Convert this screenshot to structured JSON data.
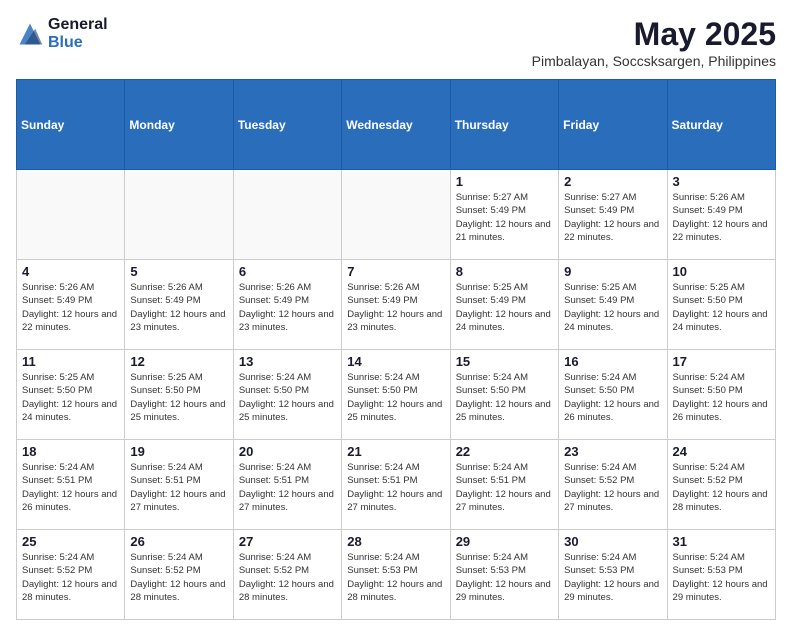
{
  "logo": {
    "general": "General",
    "blue": "Blue"
  },
  "title": {
    "month_year": "May 2025",
    "location": "Pimbalayan, Soccsksargen, Philippines"
  },
  "weekdays": [
    "Sunday",
    "Monday",
    "Tuesday",
    "Wednesday",
    "Thursday",
    "Friday",
    "Saturday"
  ],
  "weeks": [
    [
      {
        "day": "",
        "info": ""
      },
      {
        "day": "",
        "info": ""
      },
      {
        "day": "",
        "info": ""
      },
      {
        "day": "",
        "info": ""
      },
      {
        "day": "1",
        "info": "Sunrise: 5:27 AM\nSunset: 5:49 PM\nDaylight: 12 hours and 21 minutes."
      },
      {
        "day": "2",
        "info": "Sunrise: 5:27 AM\nSunset: 5:49 PM\nDaylight: 12 hours and 22 minutes."
      },
      {
        "day": "3",
        "info": "Sunrise: 5:26 AM\nSunset: 5:49 PM\nDaylight: 12 hours and 22 minutes."
      }
    ],
    [
      {
        "day": "4",
        "info": "Sunrise: 5:26 AM\nSunset: 5:49 PM\nDaylight: 12 hours and 22 minutes."
      },
      {
        "day": "5",
        "info": "Sunrise: 5:26 AM\nSunset: 5:49 PM\nDaylight: 12 hours and 23 minutes."
      },
      {
        "day": "6",
        "info": "Sunrise: 5:26 AM\nSunset: 5:49 PM\nDaylight: 12 hours and 23 minutes."
      },
      {
        "day": "7",
        "info": "Sunrise: 5:26 AM\nSunset: 5:49 PM\nDaylight: 12 hours and 23 minutes."
      },
      {
        "day": "8",
        "info": "Sunrise: 5:25 AM\nSunset: 5:49 PM\nDaylight: 12 hours and 24 minutes."
      },
      {
        "day": "9",
        "info": "Sunrise: 5:25 AM\nSunset: 5:49 PM\nDaylight: 12 hours and 24 minutes."
      },
      {
        "day": "10",
        "info": "Sunrise: 5:25 AM\nSunset: 5:50 PM\nDaylight: 12 hours and 24 minutes."
      }
    ],
    [
      {
        "day": "11",
        "info": "Sunrise: 5:25 AM\nSunset: 5:50 PM\nDaylight: 12 hours and 24 minutes."
      },
      {
        "day": "12",
        "info": "Sunrise: 5:25 AM\nSunset: 5:50 PM\nDaylight: 12 hours and 25 minutes."
      },
      {
        "day": "13",
        "info": "Sunrise: 5:24 AM\nSunset: 5:50 PM\nDaylight: 12 hours and 25 minutes."
      },
      {
        "day": "14",
        "info": "Sunrise: 5:24 AM\nSunset: 5:50 PM\nDaylight: 12 hours and 25 minutes."
      },
      {
        "day": "15",
        "info": "Sunrise: 5:24 AM\nSunset: 5:50 PM\nDaylight: 12 hours and 25 minutes."
      },
      {
        "day": "16",
        "info": "Sunrise: 5:24 AM\nSunset: 5:50 PM\nDaylight: 12 hours and 26 minutes."
      },
      {
        "day": "17",
        "info": "Sunrise: 5:24 AM\nSunset: 5:50 PM\nDaylight: 12 hours and 26 minutes."
      }
    ],
    [
      {
        "day": "18",
        "info": "Sunrise: 5:24 AM\nSunset: 5:51 PM\nDaylight: 12 hours and 26 minutes."
      },
      {
        "day": "19",
        "info": "Sunrise: 5:24 AM\nSunset: 5:51 PM\nDaylight: 12 hours and 27 minutes."
      },
      {
        "day": "20",
        "info": "Sunrise: 5:24 AM\nSunset: 5:51 PM\nDaylight: 12 hours and 27 minutes."
      },
      {
        "day": "21",
        "info": "Sunrise: 5:24 AM\nSunset: 5:51 PM\nDaylight: 12 hours and 27 minutes."
      },
      {
        "day": "22",
        "info": "Sunrise: 5:24 AM\nSunset: 5:51 PM\nDaylight: 12 hours and 27 minutes."
      },
      {
        "day": "23",
        "info": "Sunrise: 5:24 AM\nSunset: 5:52 PM\nDaylight: 12 hours and 27 minutes."
      },
      {
        "day": "24",
        "info": "Sunrise: 5:24 AM\nSunset: 5:52 PM\nDaylight: 12 hours and 28 minutes."
      }
    ],
    [
      {
        "day": "25",
        "info": "Sunrise: 5:24 AM\nSunset: 5:52 PM\nDaylight: 12 hours and 28 minutes."
      },
      {
        "day": "26",
        "info": "Sunrise: 5:24 AM\nSunset: 5:52 PM\nDaylight: 12 hours and 28 minutes."
      },
      {
        "day": "27",
        "info": "Sunrise: 5:24 AM\nSunset: 5:52 PM\nDaylight: 12 hours and 28 minutes."
      },
      {
        "day": "28",
        "info": "Sunrise: 5:24 AM\nSunset: 5:53 PM\nDaylight: 12 hours and 28 minutes."
      },
      {
        "day": "29",
        "info": "Sunrise: 5:24 AM\nSunset: 5:53 PM\nDaylight: 12 hours and 29 minutes."
      },
      {
        "day": "30",
        "info": "Sunrise: 5:24 AM\nSunset: 5:53 PM\nDaylight: 12 hours and 29 minutes."
      },
      {
        "day": "31",
        "info": "Sunrise: 5:24 AM\nSunset: 5:53 PM\nDaylight: 12 hours and 29 minutes."
      }
    ]
  ]
}
